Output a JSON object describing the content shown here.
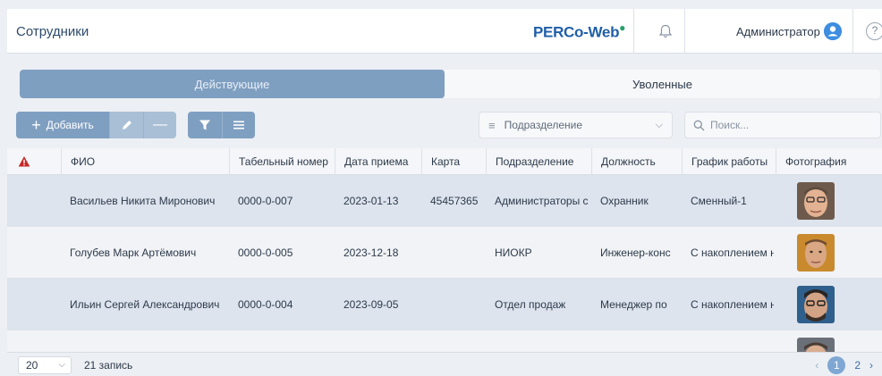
{
  "header": {
    "title": "Сотрудники",
    "brand": "PERCo-Web",
    "user": "Администратор",
    "help": "?"
  },
  "tabs": {
    "active": "Действующие",
    "inactive": "Уволенные"
  },
  "toolbar": {
    "add_label": "Добавить",
    "department_placeholder": "Подразделение",
    "search_placeholder": "Поиск..."
  },
  "table": {
    "columns": [
      "ФИО",
      "Табельный номер",
      "Дата приема",
      "Карта",
      "Подразделение",
      "Должность",
      "График работы",
      "Фотография"
    ],
    "rows": [
      {
        "name": "Васильев Никита Миронович",
        "tab": "0000-0-007",
        "date": "2023-01-13",
        "card": "45457365",
        "dept": "Администраторы с",
        "pos": "Охранник",
        "schedule": "Сменный-1"
      },
      {
        "name": "Голубев Марк Артёмович",
        "tab": "0000-0-005",
        "date": "2023-12-18",
        "card": "",
        "dept": "НИОКР",
        "pos": "Инженер-конс",
        "schedule": "С накоплением на"
      },
      {
        "name": "Ильин Сергей Александрович",
        "tab": "0000-0-004",
        "date": "2023-09-05",
        "card": "",
        "dept": "Отдел продаж",
        "pos": "Менеджер по",
        "schedule": "С накоплением на"
      }
    ]
  },
  "footer": {
    "page_size": "20",
    "count": "21 запись",
    "pages": [
      "1",
      "2"
    ],
    "current_page": "1"
  },
  "colors": {
    "accent": "#7f9fc1",
    "brand": "#1f5fa8",
    "alert": "#c62828",
    "row_shaded": "#dde4ee"
  }
}
